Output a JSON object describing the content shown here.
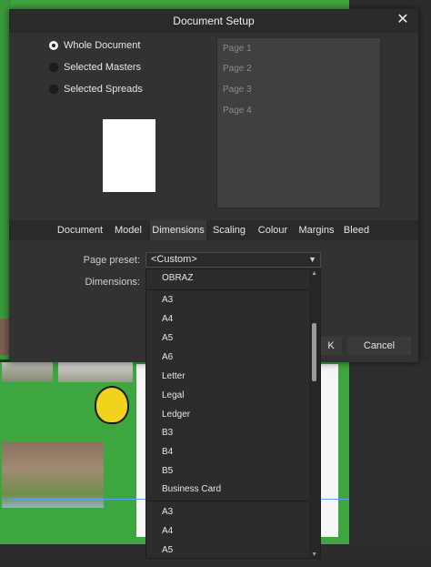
{
  "dialog": {
    "title": "Document Setup",
    "close_icon": "close-icon",
    "scope_options": [
      {
        "label": "Whole Document",
        "selected": true
      },
      {
        "label": "Selected Masters",
        "selected": false
      },
      {
        "label": "Selected Spreads",
        "selected": false
      }
    ],
    "pages": [
      "Page 1",
      "Page 2",
      "Page 3",
      "Page 4"
    ],
    "tabs": [
      "Document",
      "Model",
      "Dimensions",
      "Scaling",
      "Colour",
      "Margins",
      "Bleed"
    ],
    "active_tab": "Dimensions",
    "page_preset_label": "Page preset:",
    "page_preset_value": "<Custom>",
    "dimensions_label": "Dimensions:",
    "cancel_label": "Cancel",
    "ok_label_fragment": "K"
  },
  "dropdown": {
    "items": [
      "OBRAZ",
      "A3",
      "A4",
      "A5",
      "A6",
      "Letter",
      "Legal",
      "Ledger",
      "B3",
      "B4",
      "B5",
      "Business Card",
      "A3",
      "A4",
      "A5"
    ]
  },
  "colors": {
    "dialog_bg": "#323232",
    "titlebar_bg": "#2a2a2a",
    "canvas_green": "#3ea63e"
  }
}
